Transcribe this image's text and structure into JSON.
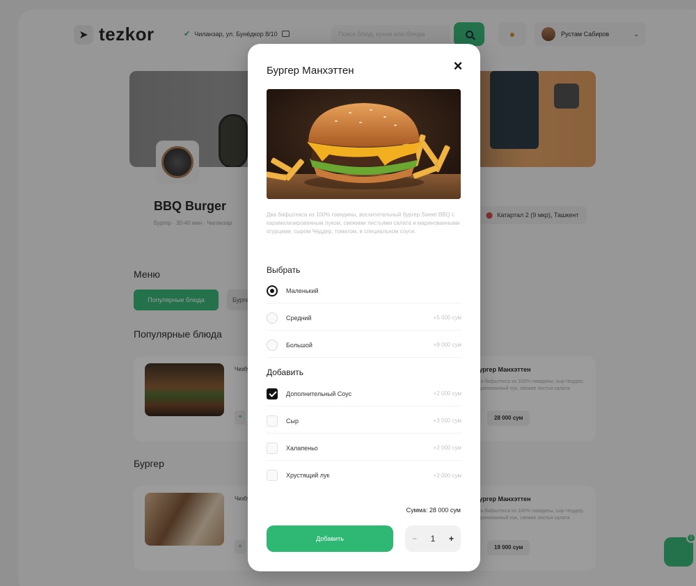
{
  "background": {
    "brand": "tezkor",
    "address": "Чиланзар, ул. Бунёдкор 8/10",
    "search_placeholder": "Поиск блюд, кухни или блюда",
    "user_name": "Рустам Сабиров",
    "restaurant": {
      "name": "BBQ Burger",
      "meta": "Бургер · 30-40 мин · Чиланзар",
      "address": "Катартал 2 (9 мкр), Ташкент"
    },
    "menu_title": "Меню",
    "categories": [
      "Популярные блюда",
      "Бургер"
    ],
    "sections": [
      "Популярные блюда",
      "Бургер"
    ],
    "cards": [
      {
        "left_title": "Чизбургер",
        "right_title": "Бургер Манхэттен",
        "right_desc": "Два бифштекса из 100% говядины, сыр Чеддер, маринованный лук, свежие листья салата",
        "price": "28 000 сум"
      },
      {
        "left_title": "Чизбургер",
        "right_title": "Бургер Манхэттен",
        "right_desc": "Два бифштекса из 100% говядины, сыр Чеддер, маринованный лук, свежие листья салата",
        "price": "19 000 сум"
      }
    ],
    "cart_count": "1"
  },
  "modal": {
    "title": "Бургер Манхэттен",
    "description": "Два бифштекса из 100% говядины, восхитительный бургер Sweet BBQ с карамелизированным луком, свежими листьями салата и маринованными огурцами, сыром Чеддер, томатом, в специальном соусе.",
    "choose_label": "Выбрать",
    "sizes": [
      {
        "name": "Маленький",
        "extra": "",
        "selected": true
      },
      {
        "name": "Средний",
        "extra": "+5 000 сум",
        "selected": false
      },
      {
        "name": "Большой",
        "extra": "+8 000 сум",
        "selected": false
      }
    ],
    "add_label": "Добавить",
    "addons": [
      {
        "name": "Дополнительный Соус",
        "extra": "+2 000 сум",
        "checked": true
      },
      {
        "name": "Сыр",
        "extra": "+3 000 сум",
        "checked": false
      },
      {
        "name": "Халапеньо",
        "extra": "+2 000 сум",
        "checked": false
      },
      {
        "name": "Хрустящий лук",
        "extra": "+2 000 сум",
        "checked": false
      }
    ],
    "sum_text": "Сумма: 28 000 сум",
    "add_button": "Добавить",
    "quantity": "1",
    "minus": "−",
    "plus": "+",
    "close_icon": "×"
  },
  "colors": {
    "accent": "#2fb774",
    "overlay": "rgba(20,20,20,0.42)"
  }
}
